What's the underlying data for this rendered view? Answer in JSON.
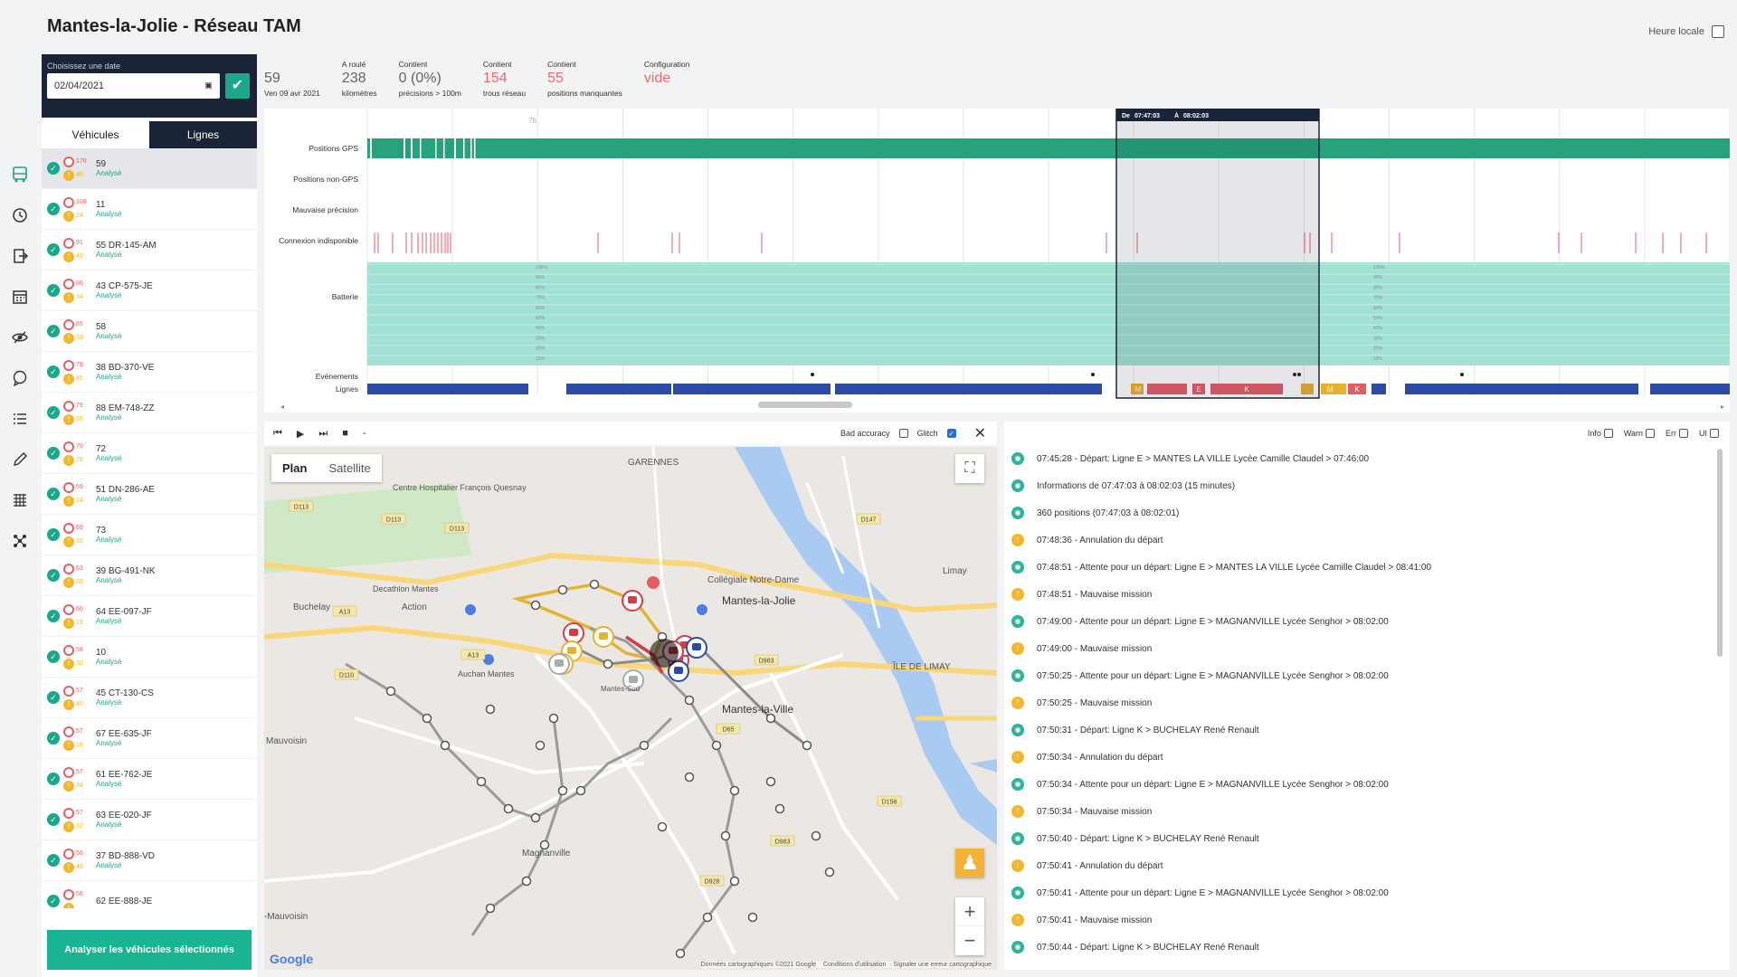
{
  "header": {
    "title": "Mantes-la-Jolie - Réseau TAM",
    "local_time_label": "Heure locale"
  },
  "sidebar_icons": [
    "bus-icon",
    "history-icon",
    "export-icon",
    "calendar-icon",
    "hidden-eye-icon",
    "chat-icon",
    "list-icon",
    "edit-icon",
    "grid-icon",
    "network-icon"
  ],
  "date_picker": {
    "label": "Choisissez une date",
    "value": "02/04/2021",
    "calendar_icon": "calendar-icon",
    "confirm_icon": "check-icon"
  },
  "tabs": [
    "Véhicules",
    "Lignes"
  ],
  "vehicles": [
    {
      "name": "59",
      "status": "Analysé",
      "red": "170",
      "yellow": "40"
    },
    {
      "name": "11",
      "status": "Analysé",
      "red": "108",
      "yellow": "24"
    },
    {
      "name": "55 DR-145-AM",
      "status": "Analysé",
      "red": "91",
      "yellow": "40"
    },
    {
      "name": "43 CP-575-JE",
      "status": "Analysé",
      "red": "86",
      "yellow": "34"
    },
    {
      "name": "58",
      "status": "Analysé",
      "red": "85",
      "yellow": "33"
    },
    {
      "name": "38 BD-370-VE",
      "status": "Analysé",
      "red": "79",
      "yellow": "45"
    },
    {
      "name": "88 EM-748-ZZ",
      "status": "Analysé",
      "red": "79",
      "yellow": "35"
    },
    {
      "name": "72",
      "status": "Analysé",
      "red": "70",
      "yellow": "28"
    },
    {
      "name": "51 DN-286-AE",
      "status": "Analysé",
      "red": "69",
      "yellow": "24"
    },
    {
      "name": "73",
      "status": "Analysé",
      "red": "69",
      "yellow": "39"
    },
    {
      "name": "39 BG-491-NK",
      "status": "Analysé",
      "red": "63",
      "yellow": "33"
    },
    {
      "name": "64 EE-097-JF",
      "status": "Analysé",
      "red": "60",
      "yellow": "19"
    },
    {
      "name": "10",
      "status": "Analysé",
      "red": "58",
      "yellow": "30"
    },
    {
      "name": "45 CT-130-CS",
      "status": "Analysé",
      "red": "57",
      "yellow": "40"
    },
    {
      "name": "67 EE-635-JF",
      "status": "Analysé",
      "red": "57",
      "yellow": "18"
    },
    {
      "name": "61 EE-762-JE",
      "status": "Analysé",
      "red": "57",
      "yellow": "34"
    },
    {
      "name": "63 EE-020-JF",
      "status": "Analysé",
      "red": "57",
      "yellow": "32"
    },
    {
      "name": "37 BD-888-VD",
      "status": "Analysé",
      "red": "56",
      "yellow": "40"
    },
    {
      "name": "62 EE-888-JE",
      "status": "",
      "red": "56",
      "yellow": ""
    }
  ],
  "analyze_button": "Analyser les véhicules sélectionnés",
  "stats": [
    {
      "title": "",
      "value": "59",
      "sub": "Ven 09 avr 2021",
      "red": false
    },
    {
      "title": "A roulé",
      "value": "238",
      "sub": "kilomètres",
      "red": false
    },
    {
      "title": "Contient",
      "value": "0 (0%)",
      "sub": "précisions > 100m",
      "red": false
    },
    {
      "title": "Contient",
      "value": "154",
      "sub": "trous réseau",
      "red": true
    },
    {
      "title": "Contient",
      "value": "55",
      "sub": "positions manquantes",
      "red": true
    },
    {
      "title": "Configuration",
      "value": "vide",
      "sub": "",
      "red": true
    }
  ],
  "timeline": {
    "rows": [
      "Positions GPS",
      "Positions non-GPS",
      "Mauvaise précision",
      "Connexion indisponible",
      "Batterie",
      "Evénements",
      "Lignes"
    ],
    "hour_marker": "7h",
    "selection": {
      "from_label": "De",
      "from": "07:47:03",
      "to_label": "À",
      "to": "08:02:03"
    },
    "battery_ticks": [
      "100%",
      "90%",
      "80%",
      "70%",
      "60%",
      "50%",
      "40%",
      "30%",
      "20%",
      "10%"
    ],
    "line_labels": [
      "M",
      "E",
      "K",
      "M",
      "K",
      "E"
    ],
    "colors": {
      "gps": "#26a37d",
      "battery": "#a2e2d4",
      "lines": "#2b4ba4",
      "errors": "#ea5d63",
      "selection": "#1a2438"
    }
  },
  "player": {
    "controls": [
      "prev-icon",
      "play-icon",
      "next-icon",
      "stop-icon"
    ],
    "speed": "-",
    "bad_accuracy": "Bad accuracy",
    "glitch": "Glitch",
    "close_icon": "close-icon"
  },
  "map": {
    "tab_plan": "Plan",
    "tab_satellite": "Satellite",
    "labels": [
      "GARENNES",
      "Centre Hospitalier François Quesnay",
      "Collégiale Notre-Dame",
      "Mantes-la-Jolie",
      "Decathlon Mantes",
      "Buchelay",
      "Auchan Mantes",
      "Mantes-Sud",
      "Mantes-la-Ville",
      "ÎLE DE LIMAY",
      "Limay",
      "Mauvoisin",
      "-Mauvoisin",
      "Magnanville",
      "Action"
    ],
    "roads": [
      "D113",
      "D113",
      "D113",
      "D147",
      "A13",
      "D110",
      "A13",
      "D983",
      "D65",
      "D158",
      "D983",
      "D928"
    ],
    "footer": [
      "Données cartographiques ©2021 Google",
      "Conditions d'utilisation",
      "Signaler une erreur cartographique"
    ],
    "logo": "Google"
  },
  "log_filters": [
    "Info",
    "Warn",
    "Err",
    "UI"
  ],
  "logs": [
    {
      "type": "info",
      "text": "07:45:28 - Départ: Ligne E > MANTES LA VILLE Lycée Camille Claudel > 07:46:00"
    },
    {
      "type": "info",
      "text": "Informations de 07:47:03 à 08:02:03 (15 minutes)"
    },
    {
      "type": "info",
      "text": "360 positions (07:47:03 à 08:02:01)"
    },
    {
      "type": "warn",
      "text": "07:48:36 - Annulation du départ"
    },
    {
      "type": "info",
      "text": "07:48:51 - Attente pour un départ: Ligne E > MANTES LA VILLE Lycée Camille Claudel > 08:41:00"
    },
    {
      "type": "warn",
      "text": "07:48:51 - Mauvaise mission"
    },
    {
      "type": "info",
      "text": "07:49:00 - Attente pour un départ: Ligne E > MAGNANVILLE Lycée Senghor > 08:02:00"
    },
    {
      "type": "warn",
      "text": "07:49:00 - Mauvaise mission"
    },
    {
      "type": "info",
      "text": "07:50:25 - Attente pour un départ: Ligne E > MAGNANVILLE Lycée Senghor > 08:02:00"
    },
    {
      "type": "warn",
      "text": "07:50:25 - Mauvaise mission"
    },
    {
      "type": "info",
      "text": "07:50:31 - Départ: Ligne K > BUCHELAY René Renault"
    },
    {
      "type": "warn",
      "text": "07:50:34 - Annulation du départ"
    },
    {
      "type": "info",
      "text": "07:50:34 - Attente pour un départ: Ligne E > MAGNANVILLE Lycée Senghor > 08:02:00"
    },
    {
      "type": "warn",
      "text": "07:50:34 - Mauvaise mission"
    },
    {
      "type": "info",
      "text": "07:50:40 - Départ: Ligne K > BUCHELAY René Renault"
    },
    {
      "type": "warn",
      "text": "07:50:41 - Annulation du départ"
    },
    {
      "type": "info",
      "text": "07:50:41 - Attente pour un départ: Ligne E > MAGNANVILLE Lycée Senghor > 08:02:00"
    },
    {
      "type": "warn",
      "text": "07:50:41 - Mauvaise mission"
    },
    {
      "type": "info",
      "text": "07:50:44 - Départ: Ligne K > BUCHELAY René Renault"
    }
  ]
}
